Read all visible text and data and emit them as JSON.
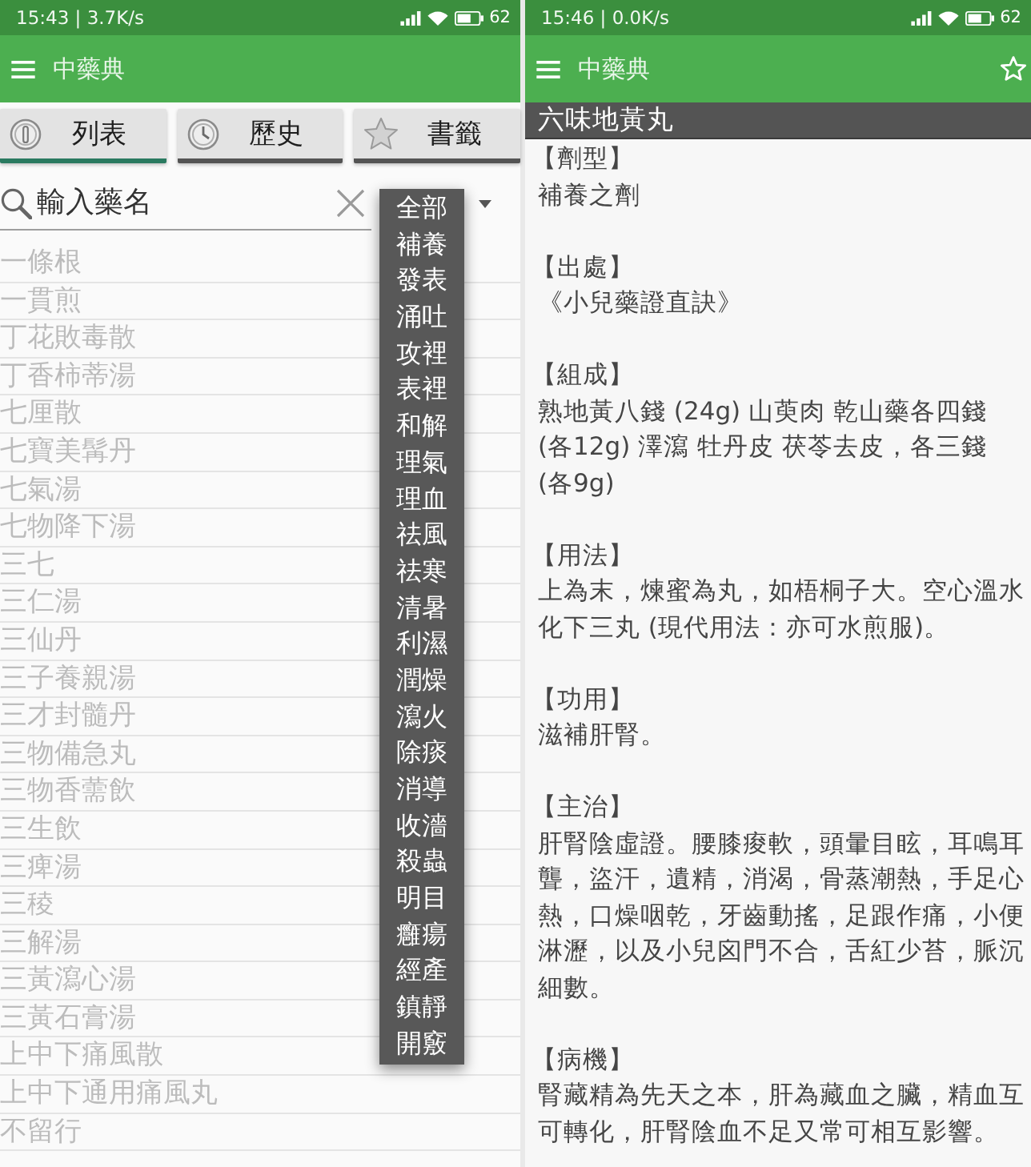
{
  "list_screen": {
    "status_bar": {
      "text": "15:43 | 3.7K/s",
      "battery": "62"
    },
    "app_bar": {
      "title": "中藥典"
    },
    "tabs": [
      {
        "label": "列表",
        "selected": true
      },
      {
        "label": "歷史",
        "selected": false
      },
      {
        "label": "書籤",
        "selected": false
      }
    ],
    "search": {
      "placeholder": "輸入藥名"
    },
    "category_dropdown": {
      "expanded": true,
      "options": [
        "全部",
        "補養",
        "發表",
        "涌吐",
        "攻裡",
        "表裡",
        "和解",
        "理氣",
        "理血",
        "祛風",
        "祛寒",
        "清暑",
        "利濕",
        "潤燥",
        "瀉火",
        "除痰",
        "消導",
        "收濇",
        "殺蟲",
        "明目",
        "癰瘍",
        "經產",
        "鎮靜",
        "開竅"
      ]
    },
    "medicines": [
      "一條根",
      "一貫煎",
      "丁花敗毒散",
      "丁香柿蒂湯",
      "七厘散",
      "七寶美髯丹",
      "七氣湯",
      "七物降下湯",
      "三七",
      "三仁湯",
      "三仙丹",
      "三子養親湯",
      "三才封髓丹",
      "三物備急丸",
      "三物香薷飲",
      "三生飲",
      "三痺湯",
      "三稜",
      "三解湯",
      "三黃瀉心湯",
      "三黃石膏湯",
      "上中下痛風散",
      "上中下通用痛風丸",
      "不留行"
    ]
  },
  "detail_screen": {
    "status_bar": {
      "text": "15:46 | 0.0K/s",
      "battery": "62"
    },
    "app_bar": {
      "title": "中藥典"
    },
    "heading": "六味地黃丸",
    "sections": [
      {
        "label": "【劑型】",
        "text": "補養之劑"
      },
      {
        "label": "【出處】",
        "text": "《小兒藥證直訣》"
      },
      {
        "label": "【組成】",
        "text": "熟地黃八錢 (24g) 山萸肉 乾山藥各四錢 (各12g) 澤瀉 牡丹皮 茯苓去皮，各三錢 (各9g)"
      },
      {
        "label": "【用法】",
        "text": "上為末，煉蜜為丸，如梧桐子大。空心溫水化下三丸 (現代用法：亦可水煎服)。"
      },
      {
        "label": "【功用】",
        "text": "滋補肝腎。"
      },
      {
        "label": "【主治】",
        "text": "肝腎陰虛證。腰膝痠軟，頭暈目眩，耳鳴耳聾，盜汗，遺精，消渴，骨蒸潮熱，手足心熱，口燥咽乾，牙齒動搖，足跟作痛，小便淋瀝，以及小兒囟門不合，舌紅少苔，脈沉細數。"
      },
      {
        "label": "【病機】",
        "text": "腎藏精為先天之本，肝為藏血之臟，精血互可轉化，肝腎陰血不足又常可相互影響。"
      }
    ]
  }
}
